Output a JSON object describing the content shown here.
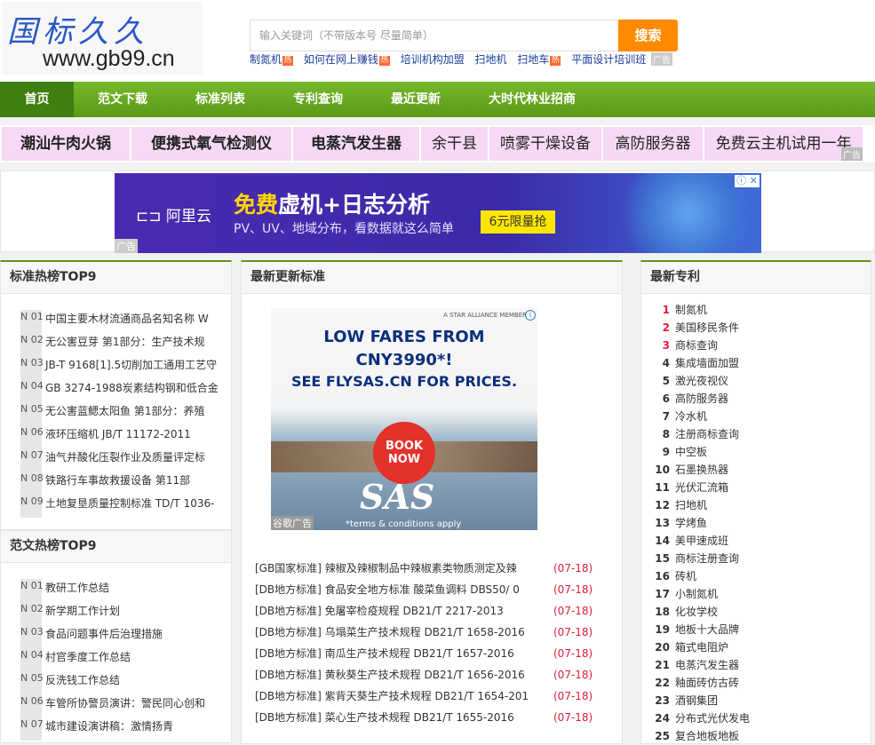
{
  "header": {
    "logo_cn": "国标久久",
    "logo_url": "www.gb99.cn",
    "search_placeholder": "输入关键词（不带版本号 尽量简单）",
    "search_button": "搜索",
    "hot_links": [
      "制氮机",
      "如何在网上赚钱",
      "培训机构加盟",
      "扫地机",
      "扫地车",
      "平面设计培训班"
    ],
    "hot_mark": "热",
    "ad_tag": "广告"
  },
  "nav": [
    "首页",
    "范文下载",
    "标准列表",
    "专利查询",
    "最近更新",
    "大时代林业招商"
  ],
  "keyword_ads": [
    "潮汕牛肉火锅",
    "便携式氧气检测仪",
    "电蒸汽发生器",
    "余干县",
    "喷雾干燥设备",
    "高防服务器",
    "免费云主机试用一年"
  ],
  "keyword_ad_tag": "广告",
  "banner": {
    "brand": "阿里云",
    "headline_highlight": "免费",
    "headline_rest": "虚机+日志分析",
    "subtitle": "PV、UV、地域分布，看数据就这么简单",
    "cta": "6元限量抢",
    "tag": "广告"
  },
  "standards_top": {
    "title": "标准热榜TOP9",
    "items": [
      {
        "num": "N 01",
        "text": "中国主要木材流通商品名知名称 W"
      },
      {
        "num": "N 02",
        "text": "无公害豆芽 第1部分：生产技术规"
      },
      {
        "num": "N 03",
        "text": "JB-T 9168[1].5切削加工通用工艺守"
      },
      {
        "num": "N 04",
        "text": "GB 3274-1988炭素结构钢和低合金"
      },
      {
        "num": "N 05",
        "text": "无公害蓝鳃太阳鱼 第1部分：养殖"
      },
      {
        "num": "N 06",
        "text": "液环压缩机 JB/T 11172-2011"
      },
      {
        "num": "N 07",
        "text": "油气井酸化压裂作业及质量评定标"
      },
      {
        "num": "N 08",
        "text": "铁路行车事故救援设备 第11部"
      },
      {
        "num": "N 09",
        "text": "土地复垦质量控制标准 TD/T 1036-"
      }
    ]
  },
  "essays_top": {
    "title": "范文热榜TOP9",
    "items": [
      {
        "num": "N 01",
        "text": "教研工作总结"
      },
      {
        "num": "N 02",
        "text": "新学期工作计划"
      },
      {
        "num": "N 03",
        "text": "食品问题事件后治理措施"
      },
      {
        "num": "N 04",
        "text": "村官季度工作总结"
      },
      {
        "num": "N 05",
        "text": "反洗钱工作总结"
      },
      {
        "num": "N 06",
        "text": "车管所协警员演讲：警民同心创和"
      },
      {
        "num": "N 07",
        "text": "城市建设演讲稿：激情扬青"
      }
    ]
  },
  "latest": {
    "title": "最新更新标准",
    "ad": {
      "member": "A STAR ALLIANCE MEMBER",
      "line1": "LOW FARES FROM",
      "line2": "CNY3990*!",
      "line3": "SEE FLYSAS.CN FOR PRICES.",
      "book": "BOOK NOW",
      "logo": "SAS",
      "terms": "*terms & conditions apply",
      "tag": "谷歌广告"
    },
    "items": [
      {
        "text": "[GB国家标准]  辣椒及辣椒制品中辣椒素类物质测定及辣",
        "date": "(07-18)"
      },
      {
        "text": "[DB地方标准]  食品安全地方标准 酸菜鱼调料 DBS50/ 0",
        "date": "(07-18)"
      },
      {
        "text": "[DB地方标准]  免屠宰检疫规程 DB21/T 2217-2013",
        "date": "(07-18)"
      },
      {
        "text": "[DB地方标准]  乌塌菜生产技术规程 DB21/T 1658-2016",
        "date": "(07-18)"
      },
      {
        "text": "[DB地方标准]  南瓜生产技术规程 DB21/T 1657-2016",
        "date": "(07-18)"
      },
      {
        "text": "[DB地方标准]  黄秋葵生产技术规程 DB21/T 1656-2016",
        "date": "(07-18)"
      },
      {
        "text": "[DB地方标准]  紫背天葵生产技术规程 DB21/T 1654-201",
        "date": "(07-18)"
      },
      {
        "text": "[DB地方标准]  菜心生产技术规程 DB21/T 1655-2016",
        "date": "(07-18)"
      }
    ]
  },
  "patents": {
    "title": "最新专利",
    "items": [
      "制氮机",
      "美国移民条件",
      "商标查询",
      "集成墙面加盟",
      "激光夜视仪",
      "高防服务器",
      "冷水机",
      "注册商标查询",
      "中空板",
      "石墨换热器",
      "光伏汇流箱",
      "扫地机",
      "学烤鱼",
      "美甲速成班",
      "商标注册查询",
      "砖机",
      "小制氮机",
      "化妆学校",
      "地板十大品牌",
      "箱式电阻炉",
      "电蒸汽发生器",
      "釉面砖仿古砖",
      "酒钢集团",
      "分布式光伏发电",
      "复合地板地板"
    ]
  }
}
